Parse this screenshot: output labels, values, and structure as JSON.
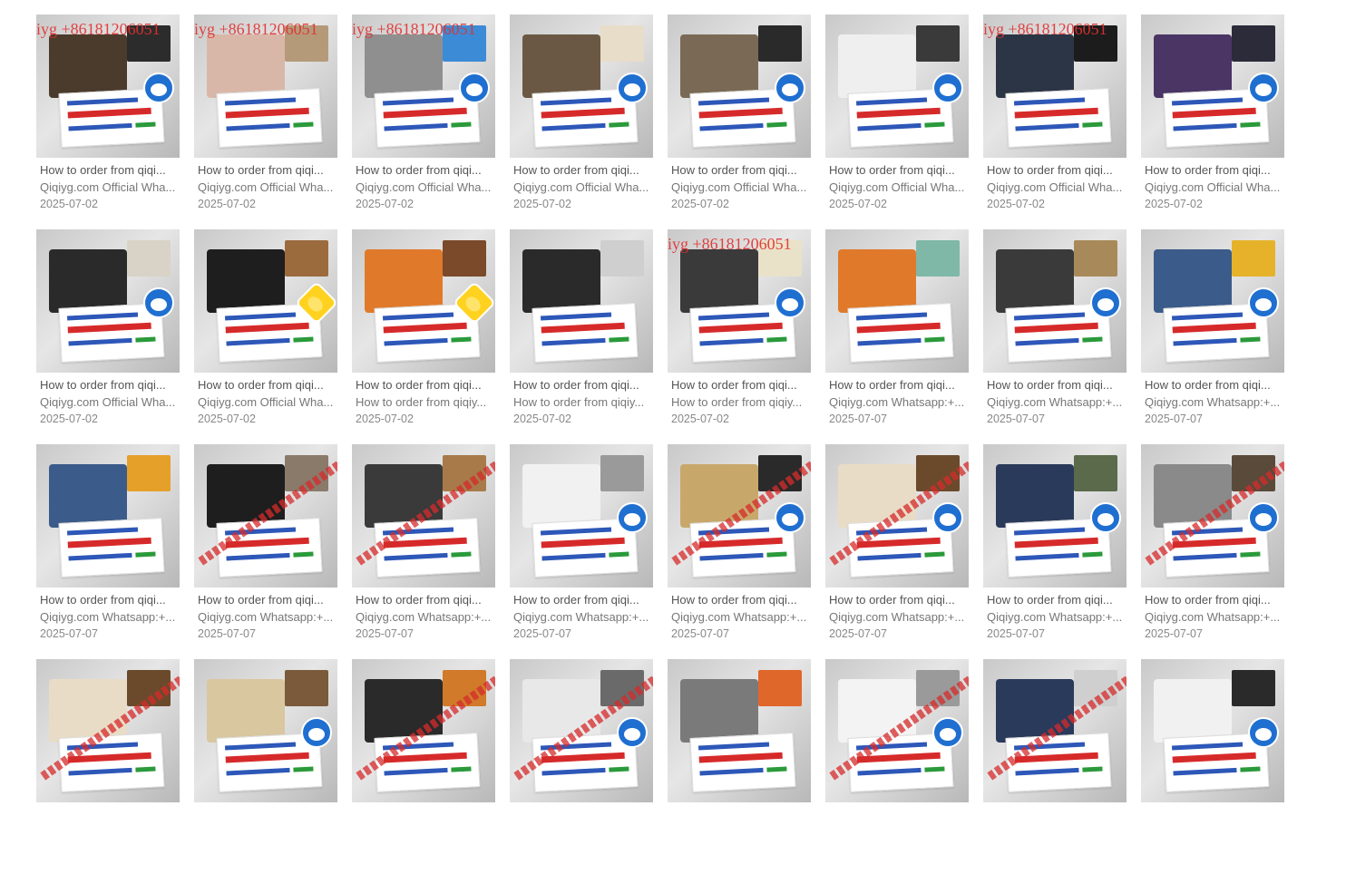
{
  "colors": {
    "watermark": "#e23030",
    "note_blue": "#2d57b8",
    "note_red": "#d62a2a",
    "mascot": "#1f6fd1"
  },
  "items": [
    {
      "title": "How to order from qiqi...",
      "sub": "Qiqiyg.com Official Wha...",
      "date": "2025-07-02",
      "watermark": "iyg +86181206051",
      "mascot": "doraemon",
      "tone": [
        "#4a3b2c",
        "#2c2c2c"
      ]
    },
    {
      "title": "How to order from qiqi...",
      "sub": "Qiqiyg.com Official Wha...",
      "date": "2025-07-02",
      "watermark": "iyg +86181206051",
      "mascot": "",
      "tone": [
        "#d9b7a8",
        "#b59a7a"
      ]
    },
    {
      "title": "How to order from qiqi...",
      "sub": "Qiqiyg.com Official Wha...",
      "date": "2025-07-02",
      "watermark": "iyg +86181206051",
      "mascot": "doraemon",
      "tone": [
        "#8f8f8f",
        "#3b8bd6"
      ]
    },
    {
      "title": "How to order from qiqi...",
      "sub": "Qiqiyg.com Official Wha...",
      "date": "2025-07-02",
      "watermark": "",
      "mascot": "doraemon",
      "tone": [
        "#6b5844",
        "#e8ddc8"
      ]
    },
    {
      "title": "How to order from qiqi...",
      "sub": "Qiqiyg.com Official Wha...",
      "date": "2025-07-02",
      "watermark": "",
      "mascot": "doraemon",
      "tone": [
        "#7a6a55",
        "#2a2a2a"
      ]
    },
    {
      "title": "How to order from qiqi...",
      "sub": "Qiqiyg.com Official Wha...",
      "date": "2025-07-02",
      "watermark": "",
      "mascot": "doraemon",
      "tone": [
        "#efefef",
        "#3a3a3a"
      ]
    },
    {
      "title": "How to order from qiqi...",
      "sub": "Qiqiyg.com Official Wha...",
      "date": "2025-07-02",
      "watermark": "iyg +86181206051",
      "mascot": "",
      "tone": [
        "#2b3545",
        "#1c1c1c"
      ]
    },
    {
      "title": "How to order from qiqi...",
      "sub": "Qiqiyg.com Official Wha...",
      "date": "2025-07-02",
      "watermark": "",
      "mascot": "doraemon",
      "tone": [
        "#4a3564",
        "#2b2b3a"
      ]
    },
    {
      "title": "How to order from qiqi...",
      "sub": "Qiqiyg.com Official Wha...",
      "date": "2025-07-02",
      "watermark": "",
      "mascot": "doraemon",
      "tone": [
        "#2a2a2a",
        "#d9d2c6"
      ]
    },
    {
      "title": "How to order from qiqi...",
      "sub": "Qiqiyg.com Official Wha...",
      "date": "2025-07-02",
      "watermark": "",
      "mascot": "star",
      "tone": [
        "#1e1e1e",
        "#9b6b3e"
      ]
    },
    {
      "title": "How to order from qiqi...",
      "sub": "How to order from qiqiy...",
      "date": "2025-07-02",
      "watermark": "",
      "mascot": "star",
      "tone": [
        "#e07a2a",
        "#7a4a2a"
      ]
    },
    {
      "title": "How to order from qiqi...",
      "sub": "How to order from qiqiy...",
      "date": "2025-07-02",
      "watermark": "",
      "mascot": "",
      "tone": [
        "#2a2a2a",
        "#cfcfcf"
      ]
    },
    {
      "title": "How to order from qiqi...",
      "sub": "How to order from qiqiy...",
      "date": "2025-07-02",
      "watermark": "iyg +86181206051",
      "mascot": "doraemon",
      "tone": [
        "#3a3a3a",
        "#e9e2c9"
      ]
    },
    {
      "title": "How to order from qiqi...",
      "sub": "Qiqiyg.com Whatsapp:+...",
      "date": "2025-07-07",
      "watermark": "",
      "mascot": "",
      "tone": [
        "#e07a2a",
        "#7fb8a6"
      ]
    },
    {
      "title": "How to order from qiqi...",
      "sub": "Qiqiyg.com Whatsapp:+...",
      "date": "2025-07-07",
      "watermark": "",
      "mascot": "doraemon",
      "tone": [
        "#3a3a3a",
        "#a88a5a"
      ]
    },
    {
      "title": "How to order from qiqi...",
      "sub": "Qiqiyg.com Whatsapp:+...",
      "date": "2025-07-07",
      "watermark": "",
      "mascot": "doraemon",
      "tone": [
        "#3b5b8a",
        "#e5b22a"
      ]
    },
    {
      "title": "How to order from qiqi...",
      "sub": "Qiqiyg.com Whatsapp:+...",
      "date": "2025-07-07",
      "watermark": "",
      "mascot": "",
      "tone": [
        "#3b5b8a",
        "#e5a02a"
      ]
    },
    {
      "title": "How to order from qiqi...",
      "sub": "Qiqiyg.com Whatsapp:+...",
      "date": "2025-07-07",
      "watermark": "",
      "mascot": "",
      "tone": [
        "#1e1e1e",
        "#8a7a6a"
      ]
    },
    {
      "title": "How to order from qiqi...",
      "sub": "Qiqiyg.com Whatsapp:+...",
      "date": "2025-07-07",
      "watermark": "",
      "mascot": "",
      "tone": [
        "#3a3a3a",
        "#a87a4a"
      ]
    },
    {
      "title": "How to order from qiqi...",
      "sub": "Qiqiyg.com Whatsapp:+...",
      "date": "2025-07-07",
      "watermark": "",
      "mascot": "doraemon",
      "tone": [
        "#f1f1f1",
        "#9a9a9a"
      ]
    },
    {
      "title": "How to order from qiqi...",
      "sub": "Qiqiyg.com Whatsapp:+...",
      "date": "2025-07-07",
      "watermark": "",
      "mascot": "doraemon",
      "tone": [
        "#c8a86a",
        "#2a2a2a"
      ]
    },
    {
      "title": "How to order from qiqi...",
      "sub": "Qiqiyg.com Whatsapp:+...",
      "date": "2025-07-07",
      "watermark": "",
      "mascot": "doraemon",
      "tone": [
        "#e9dcc6",
        "#6b4a2c"
      ]
    },
    {
      "title": "How to order from qiqi...",
      "sub": "Qiqiyg.com Whatsapp:+...",
      "date": "2025-07-07",
      "watermark": "",
      "mascot": "doraemon",
      "tone": [
        "#2a3a5a",
        "#5a6a4a"
      ]
    },
    {
      "title": "How to order from qiqi...",
      "sub": "Qiqiyg.com Whatsapp:+...",
      "date": "2025-07-07",
      "watermark": "",
      "mascot": "doraemon",
      "tone": [
        "#8a8a8a",
        "#5a4a3a"
      ]
    },
    {
      "title": "",
      "sub": "",
      "date": "",
      "watermark": "",
      "mascot": "",
      "tone": [
        "#e9dcc6",
        "#6b4a2c"
      ]
    },
    {
      "title": "",
      "sub": "",
      "date": "",
      "watermark": "",
      "mascot": "doraemon",
      "tone": [
        "#d9c7a0",
        "#7a5a3a"
      ]
    },
    {
      "title": "",
      "sub": "",
      "date": "",
      "watermark": "",
      "mascot": "",
      "tone": [
        "#2a2a2a",
        "#d07a2a"
      ]
    },
    {
      "title": "",
      "sub": "",
      "date": "",
      "watermark": "",
      "mascot": "doraemon",
      "tone": [
        "#e8e8e8",
        "#6a6a6a"
      ]
    },
    {
      "title": "",
      "sub": "",
      "date": "",
      "watermark": "",
      "mascot": "",
      "tone": [
        "#7a7a7a",
        "#e0672a"
      ]
    },
    {
      "title": "",
      "sub": "",
      "date": "",
      "watermark": "",
      "mascot": "doraemon",
      "tone": [
        "#f3f3f3",
        "#9a9a9a"
      ]
    },
    {
      "title": "",
      "sub": "",
      "date": "",
      "watermark": "",
      "mascot": "",
      "tone": [
        "#2a3a5a",
        "#cfcfcf"
      ]
    },
    {
      "title": "",
      "sub": "",
      "date": "",
      "watermark": "",
      "mascot": "doraemon",
      "tone": [
        "#f1f1f1",
        "#2a2a2a"
      ]
    }
  ]
}
